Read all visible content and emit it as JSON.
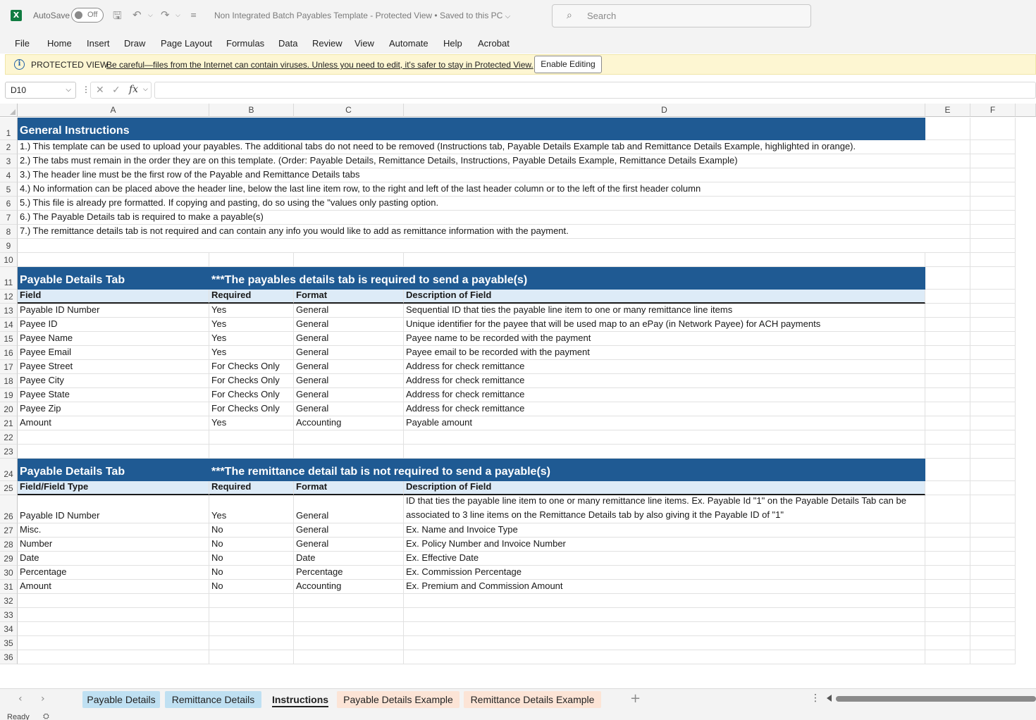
{
  "titlebar": {
    "autosave_label": "AutoSave",
    "autosave_state": "Off",
    "document_title": "Non Integrated Batch Payables Template  -  Protected View  •  Saved to this PC",
    "search_placeholder": "Search",
    "icons": [
      "excel-logo-icon",
      "save-icon",
      "undo-icon",
      "redo-icon",
      "customize-qat-icon",
      "search-icon"
    ]
  },
  "menu": {
    "items": [
      "File",
      "Home",
      "Insert",
      "Draw",
      "Page Layout",
      "Formulas",
      "Data",
      "Review",
      "View",
      "Automate",
      "Help",
      "Acrobat"
    ]
  },
  "protected_view": {
    "title": "PROTECTED VIEW",
    "message": "Be careful—files from the Internet can contain viruses. Unless you need to edit, it's safer to stay in Protected View.",
    "button": "Enable Editing",
    "info_glyph": "i"
  },
  "formula_bar": {
    "name_box": "D10",
    "fx_label": "fx",
    "formula": ""
  },
  "columns": [
    "A",
    "B",
    "C",
    "D",
    "E",
    "F"
  ],
  "row_numbers": [
    "1",
    "2",
    "3",
    "4",
    "5",
    "6",
    "7",
    "8",
    "9",
    "10",
    "11",
    "12",
    "13",
    "14",
    "15",
    "16",
    "17",
    "18",
    "19",
    "20",
    "21",
    "22",
    "23",
    "24",
    "25",
    "26",
    "27",
    "28",
    "29",
    "30",
    "31",
    "32",
    "33",
    "34",
    "35",
    "36"
  ],
  "general": {
    "title": "General Instructions",
    "lines": [
      "1.) This template can be used to upload your payables. The additional tabs do not need to be removed (Instructions tab, Payable Details Example tab and Remittance Details Example, highlighted in orange).",
      "2.) The tabs must remain in the order they are on this template. (Order: Payable Details, Remittance Details, Instructions, Payable Details Example, Remittance Details Example)",
      "3.) The header line must be the first row of the Payable and Remittance Details tabs",
      "4.) No information can be placed above the header line, below the last line item row,  to the right and left of the last header column or to the left of the first header column",
      "5.) This file is already pre formatted. If copying and pasting, do so using the \"values only pasting option.",
      "6.) The Payable Details tab is required to make a payable(s)",
      "7.) The remittance details tab is not required and can contain any info you would like to add as remittance information with the payment."
    ]
  },
  "payable_section": {
    "title": "Payable Details Tab",
    "note": "***The payables details tab is required to send a payable(s)",
    "headers": [
      "Field",
      "Required",
      "Format",
      "Description of Field"
    ],
    "rows": [
      [
        "Payable ID Number",
        "Yes",
        "General",
        "Sequential ID that ties the payable line item to one or many remittance line items"
      ],
      [
        "Payee ID",
        "Yes",
        "General",
        "Unique identifier for the payee that will be used map to an ePay (in Network Payee) for ACH payments"
      ],
      [
        "Payee Name",
        "Yes",
        "General",
        "Payee name to be recorded with the payment"
      ],
      [
        "Payee Email",
        "Yes",
        "General",
        "Payee email to be recorded with the payment"
      ],
      [
        "Payee Street",
        "For Checks Only",
        "General",
        "Address for check remittance"
      ],
      [
        "Payee City",
        "For Checks Only",
        "General",
        "Address for check remittance"
      ],
      [
        "Payee State",
        "For Checks Only",
        "General",
        "Address for check remittance"
      ],
      [
        "Payee Zip",
        "For Checks Only",
        "General",
        "Address for check remittance"
      ],
      [
        "Amount",
        "Yes",
        "Accounting",
        "Payable amount"
      ]
    ]
  },
  "remittance_section": {
    "title": "Payable Details Tab",
    "note": "***The remittance detail tab is not required to send a payable(s)",
    "headers": [
      "Field/Field Type",
      "Required",
      "Format",
      "Description of Field"
    ],
    "rows": [
      [
        "Payable ID Number",
        "Yes",
        "General",
        "ID that ties the payable line item to one or many remittance line items. Ex. Payable Id \"1\" on the Payable Details Tab can be associated to 3 line items on the Remittance Details tab by also giving it the Payable ID of \"1\""
      ],
      [
        "Misc.",
        "No",
        "General",
        "Ex. Name and Invoice Type"
      ],
      [
        "Number",
        "No",
        "General",
        "Ex. Policy Number and Invoice Number"
      ],
      [
        "Date",
        "No",
        "Date",
        "Ex. Effective Date"
      ],
      [
        "Percentage",
        "No",
        "Percentage",
        "Ex. Commission Percentage"
      ],
      [
        "Amount",
        "No",
        "Accounting",
        "Ex. Premium and Commission Amount"
      ]
    ]
  },
  "sheet_tabs": [
    {
      "label": "Payable Details",
      "style": "blue"
    },
    {
      "label": "Remittance Details",
      "style": "blue"
    },
    {
      "label": "Instructions",
      "style": "active"
    },
    {
      "label": "Payable Details Example",
      "style": "orange"
    },
    {
      "label": "Remittance Details Example",
      "style": "orange"
    }
  ],
  "status": {
    "ready": "Ready"
  },
  "colors": {
    "band_dark": "#1f5a93",
    "band_light": "#ddebf7",
    "tab_blue": "#bfe0f2",
    "tab_orange": "#fce4d6",
    "protected_bar": "#fdf6d2",
    "excel_green": "#107c41"
  }
}
